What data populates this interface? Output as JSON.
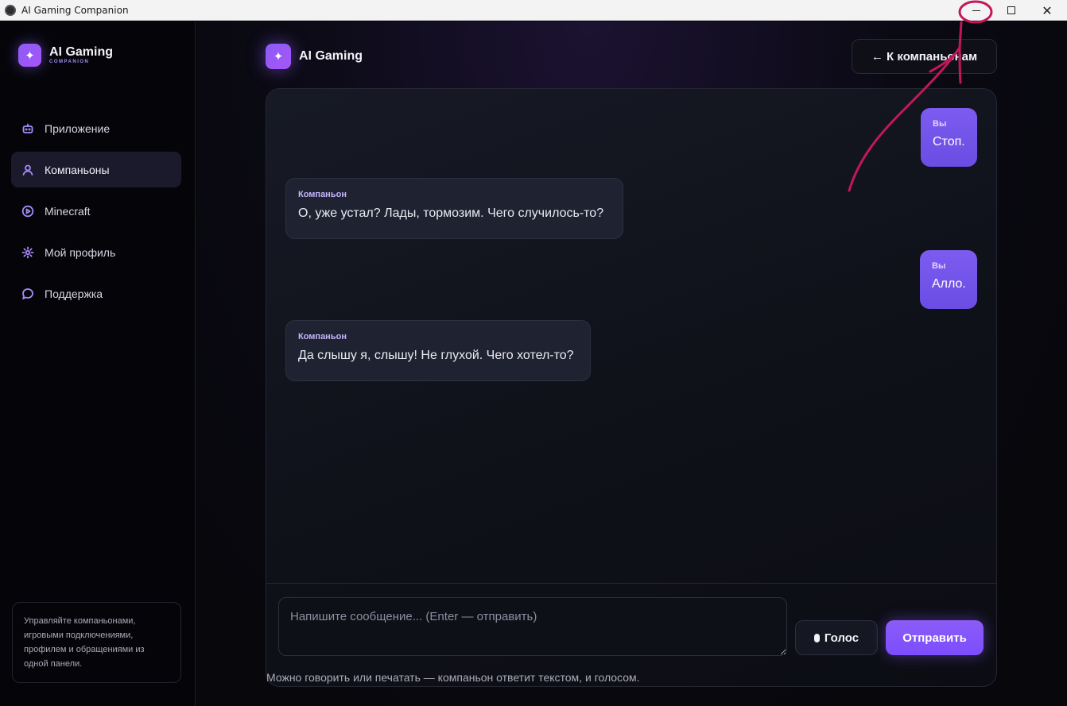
{
  "window": {
    "title": "AI Gaming Companion",
    "controls": {
      "minimize": "minimize-icon",
      "maximize": "maximize-icon",
      "close": "✕"
    }
  },
  "sidebar": {
    "brand": {
      "title": "AI Gaming",
      "subtitle": "COMPANION",
      "icon": "✦"
    },
    "items": [
      {
        "label": "Приложение",
        "icon": "robot-icon",
        "active": false
      },
      {
        "label": "Компаньоны",
        "icon": "user-icon",
        "active": true
      },
      {
        "label": "Minecraft",
        "icon": "play-circle-icon",
        "active": false
      },
      {
        "label": "Мой профиль",
        "icon": "gear-icon",
        "active": false
      },
      {
        "label": "Поддержка",
        "icon": "chat-bubble-icon",
        "active": false
      }
    ],
    "note": "Управляйте компаньонами, игровыми подключениями, профилем и обращениями из одной панели."
  },
  "header": {
    "title": "AI Gaming",
    "icon": "✦",
    "back_button": "← К компаньонам"
  },
  "chat": {
    "messages": [
      {
        "role": "user",
        "sender": "Вы",
        "text": "Стоп."
      },
      {
        "role": "bot",
        "sender": "Компаньон",
        "text": "О, уже устал? Лады, тормозим. Чего случилось-то?"
      },
      {
        "role": "user",
        "sender": "Вы",
        "text": "Алло."
      },
      {
        "role": "bot",
        "sender": "Компаньон",
        "text": "Да слышу я, слышу! Не глухой. Чего хотел-то?"
      }
    ],
    "input": {
      "placeholder": "Напишите сообщение... (Enter — отправить)",
      "value": ""
    },
    "voice_button": "Голос",
    "send_button": "Отправить",
    "hint": "Можно говорить или печатать — компаньон ответит текстом, и голосом."
  },
  "colors": {
    "accent": "#8b5cf6",
    "user_bubble": "#7458ec",
    "bot_bubble": "#1f2230",
    "annotation": "#c2185b"
  }
}
